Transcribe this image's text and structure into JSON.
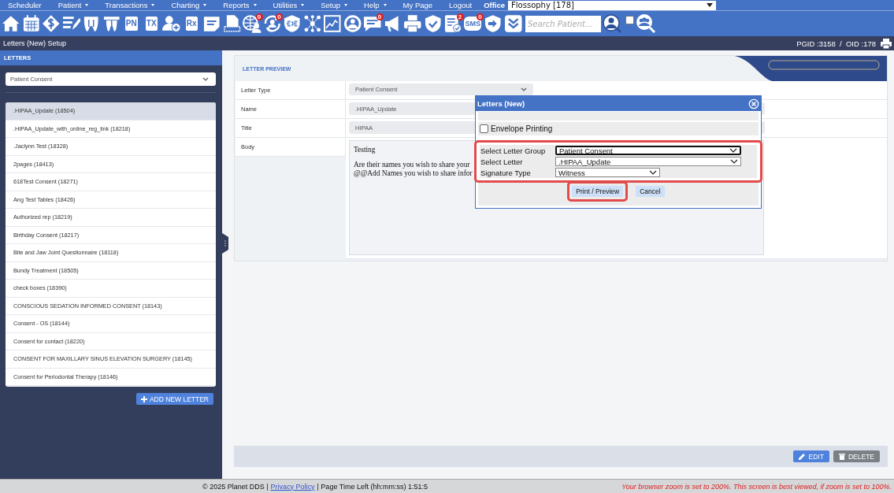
{
  "menu": [
    {
      "label": "Scheduler",
      "has_menu": false
    },
    {
      "label": "Patient",
      "has_menu": true
    },
    {
      "label": "Transactions",
      "has_menu": true
    },
    {
      "label": "Charting",
      "has_menu": true
    },
    {
      "label": "Reports",
      "has_menu": true
    },
    {
      "label": "Utilities",
      "has_menu": true
    },
    {
      "label": "Setup",
      "has_menu": true
    },
    {
      "label": "Help",
      "has_menu": true
    },
    {
      "label": "My Page",
      "has_menu": false
    },
    {
      "label": "Logout",
      "has_menu": false
    }
  ],
  "office": {
    "label": "Office",
    "value": "Flossophy [178]"
  },
  "toolbar": [
    {
      "label": "PN"
    },
    {
      "label": "TX"
    },
    {
      "label": "Rx"
    },
    {
      "badge": "0"
    },
    {
      "badge": "0"
    },
    {
      "badge": "0"
    },
    {
      "badge": "2"
    },
    {
      "label": "SMS",
      "badge": "0"
    }
  ],
  "search": {
    "placeholder": "Search Patient..."
  },
  "group_search": {
    "checked": false
  },
  "header": {
    "title": "Letters (New) Setup",
    "ids": "PGID :3158  /  OID :178"
  },
  "sidebar": {
    "title": "LETTERS",
    "filter": "Patient Consent",
    "add_button": "ADD NEW LETTER",
    "items": [
      {
        "label": ".HIPAA_Update (18504)",
        "selected": true
      },
      {
        "label": ".HIPAA_Update_with_online_reg_link (18218)",
        "selected": false
      },
      {
        "label": ".Jaclynn Test (18328)",
        "selected": false
      },
      {
        "label": "2pages (18413)",
        "selected": false
      },
      {
        "label": "618Test Consent (18271)",
        "selected": false
      },
      {
        "label": "Ang Test Tables (18426)",
        "selected": false
      },
      {
        "label": "Authorized rep (18219)",
        "selected": false
      },
      {
        "label": "Birthday Consent (18217)",
        "selected": false
      },
      {
        "label": "Bite and Jaw Joint Questionnaire (18118)",
        "selected": false
      },
      {
        "label": "Bundy Treatment (18505)",
        "selected": false
      },
      {
        "label": "check boxes (18390)",
        "selected": false
      },
      {
        "label": "CONSCIOUS SEDATION INFORMED CONSENT (18143)",
        "selected": false
      },
      {
        "label": "Consent - OS (18144)",
        "selected": false
      },
      {
        "label": "Consent for contact (18220)",
        "selected": false
      },
      {
        "label": "CONSENT FOR MAXILLARY SINUS ELEVATION SURGERY (18145)",
        "selected": false
      },
      {
        "label": "Consent for Periodontal Therapy (18146)",
        "selected": false
      }
    ]
  },
  "preview": {
    "title": "LETTER PREVIEW",
    "fields": [
      {
        "label": "Letter Type",
        "kind": "select",
        "value": "Patient Consent"
      },
      {
        "label": "Name",
        "kind": "text",
        "value": ".HIPAA_Update"
      },
      {
        "label": "Title",
        "kind": "text",
        "value": "HIPAA"
      },
      {
        "label": "Body",
        "kind": "body",
        "paragraphs": [
          "Testing",
          "Are their names you wish to share your",
          "@@Add Names you wish to share infor"
        ]
      }
    ]
  },
  "actions": [
    {
      "label": "EDIT",
      "kind": "edit"
    },
    {
      "label": "DELETE",
      "kind": "delete"
    }
  ],
  "modal": {
    "title": "Letters (New)",
    "envelope": {
      "label": "Envelope Printing",
      "checked": false
    },
    "rows_highlighted": true,
    "rows": [
      {
        "label": "Select Letter Group",
        "value": "Patient Consent",
        "focused": true
      },
      {
        "label": "Select Letter",
        "value": ".HIPAA_Update",
        "focused": false
      },
      {
        "label": "Signature Type",
        "value": "Witness",
        "focused": false
      }
    ],
    "buttons": [
      {
        "label": "Print / Preview",
        "highlighted": true
      },
      {
        "label": "Cancel",
        "highlighted": false
      }
    ]
  },
  "footer": {
    "copyright": "© 2025 Planet DDS |",
    "link": "Privacy Policy",
    "timer": "| Page Time Left (hh:mm:ss) 1:51:5",
    "warning": "Your browser zoom is set to 200%. This screen is best viewed, if zoom is set to 100%."
  }
}
